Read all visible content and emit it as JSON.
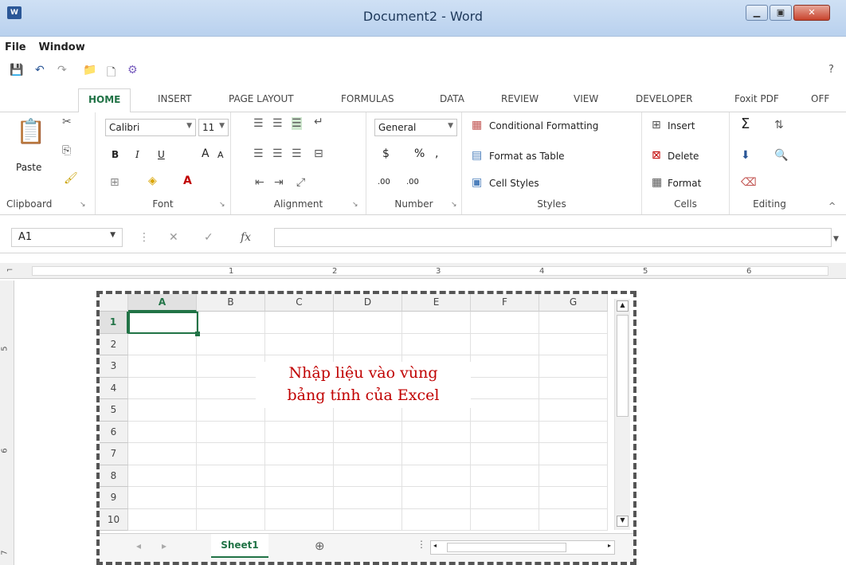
{
  "window": {
    "title": "Document2 - Word",
    "app_icon": "W",
    "minimize": "▁",
    "maximize": "▣",
    "close": "✕"
  },
  "menu": {
    "file": "File",
    "window": "Window"
  },
  "qat": {
    "more": "?"
  },
  "tabs": [
    "HOME",
    "INSERT",
    "PAGE LAYOUT",
    "FORMULAS",
    "DATA",
    "REVIEW",
    "VIEW",
    "DEVELOPER",
    "Foxit PDF",
    "OFF"
  ],
  "ribbon": {
    "clipboard": {
      "paste": "Paste",
      "label": "Clipboard"
    },
    "font": {
      "name": "Calibri",
      "size": "11",
      "bold": "B",
      "italic": "I",
      "underline": "U",
      "grow": "A",
      "shrink": "A",
      "label": "Font"
    },
    "alignment": {
      "label": "Alignment"
    },
    "number": {
      "format": "General",
      "currency": "$",
      "percent": "%",
      "comma": ",",
      "inc_dec": ".00",
      "label": "Number"
    },
    "styles": {
      "conditional": "Conditional Formatting",
      "format_table": "Format as Table",
      "cell_styles": "Cell Styles",
      "label": "Styles"
    },
    "cells": {
      "insert": "Insert",
      "delete": "Delete",
      "format": "Format",
      "label": "Cells"
    },
    "editing": {
      "sum": "Σ",
      "label": "Editing"
    }
  },
  "formula_bar": {
    "name_box": "A1",
    "cancel": "✕",
    "enter": "✓",
    "fx": "fx"
  },
  "ruler": {
    "marks": [
      "1",
      "2",
      "3",
      "4",
      "5",
      "6"
    ]
  },
  "left_ruler": {
    "marks": [
      "5",
      "6",
      "7"
    ]
  },
  "sheet": {
    "columns": [
      "A",
      "B",
      "C",
      "D",
      "E",
      "F",
      "G"
    ],
    "rows": [
      "1",
      "2",
      "3",
      "4",
      "5",
      "6",
      "7",
      "8",
      "9",
      "10"
    ],
    "active_cell": "A1",
    "overlay_line1": "Nhập liệu vào vùng",
    "overlay_line2": "bảng tính của Excel",
    "tab_name": "Sheet1",
    "add_sheet": "⊕"
  },
  "colors": {
    "accent": "#217346",
    "overlay_text": "#c00000"
  }
}
